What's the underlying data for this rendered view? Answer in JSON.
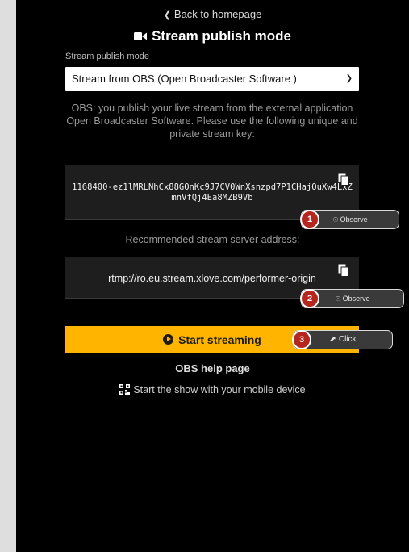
{
  "nav": {
    "back_label": "Back to homepage"
  },
  "header": {
    "title": "Stream publish mode"
  },
  "publish_mode": {
    "label": "Stream publish mode",
    "selected": "Stream from OBS (Open Broadcaster Software )"
  },
  "obs_description": "OBS: you publish your live stream from the external application Open Broadcaster Software. Please use the following unique and private stream key:",
  "stream_key": "1168400-ez1lMRLNhCx88GOnKc9J7CV0WnXsnzpd7P1CHajQuXw4LxZmnVfQj4Ea8MZB9Vb",
  "server": {
    "label": "Recommended stream server address:",
    "address": "rtmp://ro.eu.stream.xlove.com/performer-origin"
  },
  "actions": {
    "start_label": "Start streaming",
    "help_label": "OBS help page",
    "mobile_label": "Start the show with your mobile device"
  },
  "annotations": [
    {
      "number": "1",
      "label": "Observe"
    },
    {
      "number": "2",
      "label": "Observe"
    },
    {
      "number": "3",
      "label": "Click"
    }
  ],
  "colors": {
    "accent": "#ffb400",
    "marker": "#b5261e",
    "panel": "#000000"
  },
  "icons": [
    "chevron-left-icon",
    "camera-icon",
    "copy-icon",
    "play-icon",
    "qr-code-icon",
    "eye-icon",
    "cursor-icon"
  ]
}
